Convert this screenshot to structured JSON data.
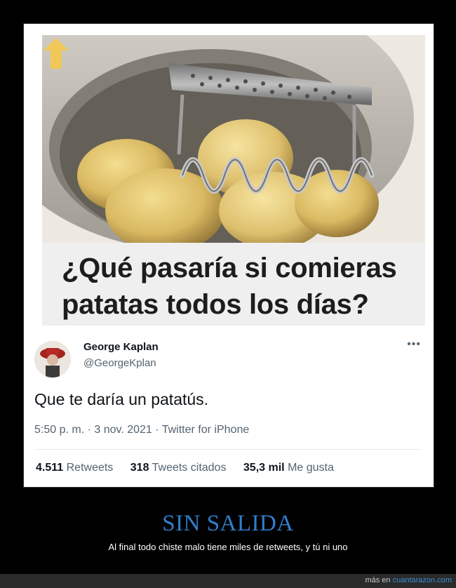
{
  "post": {
    "headline": "¿Qué pasaría si comieras patatas todos los días?",
    "tweet": {
      "name": "George Kaplan",
      "handle": "@GeorgeKplan",
      "text": "Que te daría un patatús.",
      "meta": "5:50 p. m. · 3 nov. 2021 · Twitter for iPhone",
      "stats": [
        {
          "count": "4.511",
          "label": "Retweets"
        },
        {
          "count": "318",
          "label": "Tweets citados"
        },
        {
          "count": "35,3 mil",
          "label": "Me gusta"
        }
      ]
    }
  },
  "caption": {
    "title": "SIN SALIDA",
    "subtitle": "Al final todo chiste malo tiene miles de retweets, y tú ni uno"
  },
  "footer": {
    "prefix": "más en",
    "link": "cuantarazon.com"
  },
  "colors": {
    "caption": "#2f7fcb",
    "link": "#3a8fd6",
    "arrow": "#f5c84c"
  },
  "icons": {
    "more": "more-options-icon",
    "arrow": "up-arrow-icon"
  }
}
